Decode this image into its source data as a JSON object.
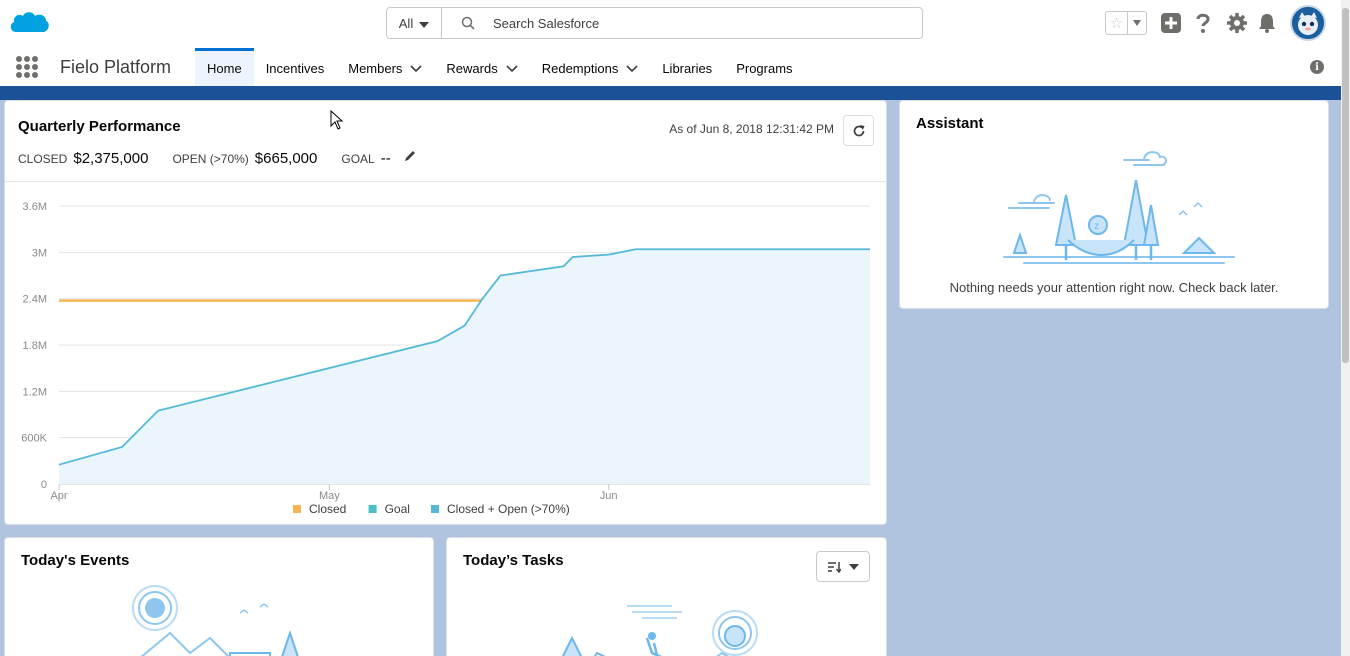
{
  "header": {
    "search": {
      "scope": "All",
      "placeholder": "Search Salesforce"
    }
  },
  "nav": {
    "app_name": "Fielo Platform",
    "items": [
      {
        "label": "Home",
        "active": true,
        "dropdown": false
      },
      {
        "label": "Incentives",
        "active": false,
        "dropdown": false
      },
      {
        "label": "Members",
        "active": false,
        "dropdown": true
      },
      {
        "label": "Rewards",
        "active": false,
        "dropdown": true
      },
      {
        "label": "Redemptions",
        "active": false,
        "dropdown": true
      },
      {
        "label": "Libraries",
        "active": false,
        "dropdown": false
      },
      {
        "label": "Programs",
        "active": false,
        "dropdown": false
      }
    ]
  },
  "performance": {
    "title": "Quarterly Performance",
    "closed_label": "CLOSED",
    "closed_value": "$2,375,000",
    "open_label": "OPEN (>70%)",
    "open_value": "$665,000",
    "goal_label": "GOAL",
    "goal_value": "--",
    "as_of": "As of Jun 8, 2018 12:31:42 PM"
  },
  "chart_data": {
    "type": "area",
    "y_ticks": [
      "0",
      "600K",
      "1.2M",
      "1.8M",
      "2.4M",
      "3M",
      "3.6M"
    ],
    "ylim": [
      0,
      3600000
    ],
    "x_ticks": [
      "Apr",
      "May",
      "Jun"
    ],
    "x_tick_days": [
      0,
      30,
      61
    ],
    "xlim": [
      0,
      90
    ],
    "grid": true,
    "legend_position": "bottom",
    "series": [
      {
        "name": "Closed",
        "color": "#f8b452",
        "type": "line",
        "points": [
          [
            0,
            2375000
          ],
          [
            90,
            2375000
          ]
        ]
      },
      {
        "name": "Goal",
        "color": "#4bc0c8",
        "type": "line",
        "points": []
      },
      {
        "name": "Closed + Open (>70%)",
        "color": "#54b9d8",
        "type": "area",
        "points": [
          [
            0,
            250000
          ],
          [
            7,
            480000
          ],
          [
            11,
            950000
          ],
          [
            42,
            1850000
          ],
          [
            45,
            2050000
          ],
          [
            47,
            2400000
          ],
          [
            49,
            2700000
          ],
          [
            56,
            2820000
          ],
          [
            57,
            2940000
          ],
          [
            61,
            2970000
          ],
          [
            64,
            3040000
          ],
          [
            90,
            3040000
          ]
        ]
      }
    ]
  },
  "assistant": {
    "title": "Assistant",
    "message": "Nothing needs your attention right now. Check back later."
  },
  "events": {
    "title": "Today's Events"
  },
  "tasks": {
    "title": "Today’s Tasks"
  }
}
